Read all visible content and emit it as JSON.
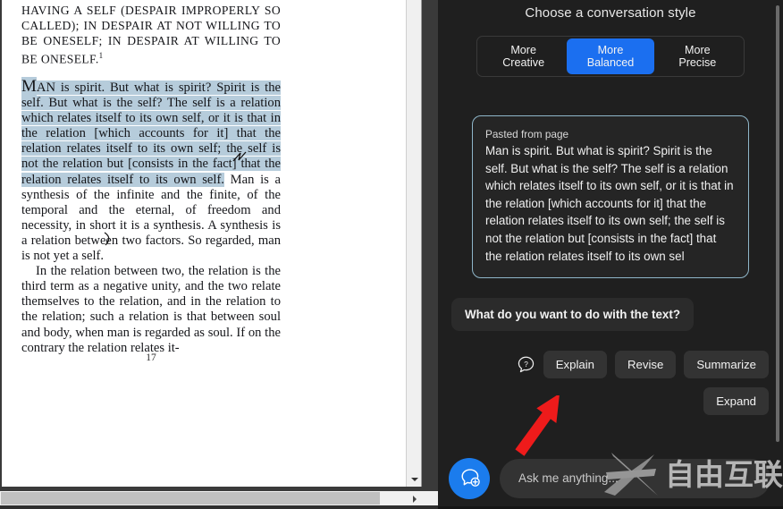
{
  "document": {
    "heading": "DESPAIR AT NOT BEING CONSCIOUS OF HAVING A SELF (DESPAIR IMPROPERLY SO CALLED); IN DESPAIR AT NOT WILLING TO BE ONESELF; IN DESPAIR AT WILLING TO BE ONESELF.",
    "heading_footnote": "1",
    "paragraph1_dropcap": "M",
    "paragraph1_smallcaps": "AN",
    "paragraph1": " is spirit. But what is spirit? Spirit is the self. But what is the self? The self is a relation which relates itself to its own self, or it is that in the relation [which accounts for it] that the relation relates itself to its own self; the self is not the relation but [consists in the fact] that the relation relates itself to its own self.",
    "paragraph1_tail": " Man is a synthesis of the infinite and the finite, of the temporal and the eternal, of freedom and necessity, in short it is a synthesis. A synthesis is a relation between two factors. So regarded, man is not yet a self.",
    "paragraph2": "In the relation between two, the relation is the third term as a negative unity, and the two relate themselves to the relation, and in the relation to the relation; such a relation is that between soul and body, when man is regarded as soul. If on the contrary the relation relates it-",
    "page_number": "17"
  },
  "chat": {
    "style_title": "Choose a conversation style",
    "styles": [
      {
        "line1": "More",
        "line2": "Creative",
        "active": false
      },
      {
        "line1": "More",
        "line2": "Balanced",
        "active": true
      },
      {
        "line1": "More",
        "line2": "Precise",
        "active": false
      }
    ],
    "pasted": {
      "label": "Pasted from page",
      "text": "Man is spirit. But what is spirit? Spirit is the self. But what is the self? The self is a relation which relates itself to its own self, or it is that in the relation [which accounts for it] that the relation relates itself to its own self; the self is not the relation but [consists in the fact] that the relation relates itself to its own sel"
    },
    "assistant_prompt": "What do you want to do with the text?",
    "actions": [
      "Explain",
      "Revise",
      "Summarize"
    ],
    "actions_second_row": [
      "Expand"
    ],
    "input_placeholder": "Ask me anything...",
    "help_icon": "question-chat-icon",
    "new_chat_icon": "new-chat-bubble-icon"
  },
  "watermark": {
    "text": "自由互联",
    "mark": "X"
  },
  "colors": {
    "accent_blue": "#1b6ff0",
    "button_blue": "#1b7ced",
    "chat_bg": "#1f1f1f",
    "chip_bg": "#333333",
    "highlight": "#b6ccdb",
    "arrow_red": "#ee1b1b"
  }
}
